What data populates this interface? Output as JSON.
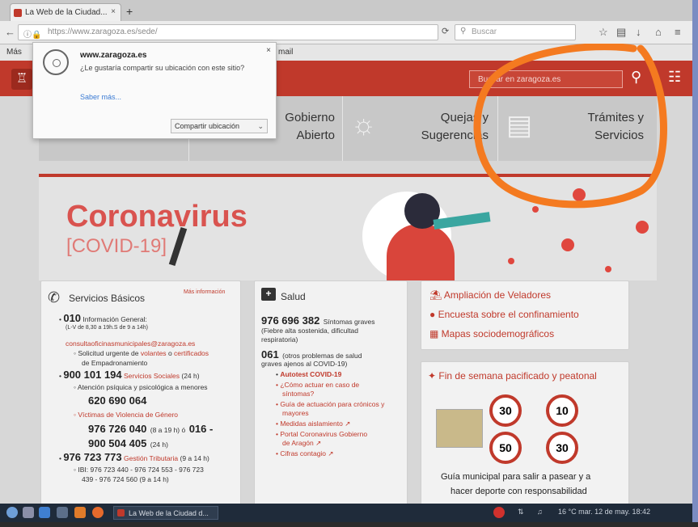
{
  "browser": {
    "tab_title": "La Web de la Ciudad...",
    "tab_close": "×",
    "new_tab": "+",
    "url": "https://www.zaragoza.es/sede/",
    "search_placeholder": "Buscar",
    "bookmarks": [
      "Más",
      "mail"
    ]
  },
  "site": {
    "search_placeholder": "Buscar en zaragoza.es",
    "tiles": [
      {
        "label_1": "Gobierno",
        "label_2": "Abierto"
      },
      {
        "label_1": "Quejas y",
        "label_2": "Sugerencias"
      },
      {
        "label_1": "Trámites y",
        "label_2": "Servicios"
      }
    ],
    "banner": {
      "title": "Coronavirus",
      "subtitle": "[COVID-19]"
    }
  },
  "permission_popup": {
    "site": "www.zaragoza.es",
    "question": "¿Le gustaría compartir su ubicación con este sitio?",
    "learn_more": "Saber más...",
    "share_button": "Compartir ubicación",
    "close": "×"
  },
  "servicios_basicos": {
    "title": "Servicios Básicos",
    "more": "Más información",
    "l1_num": "010",
    "l1_text": "Información General:",
    "l1_hours": "(L-V de 8,30 a 19h.S de 9 a 14h)",
    "email": "consultaoficinasmunicipales@zaragoza.es",
    "l2_pre": "Solicitud urgente de",
    "l2_link1": "volantes",
    "l2_mid": "o",
    "l2_link2": "certificados",
    "l2_post": "de Empadronamiento",
    "l3_num": "900 101 194",
    "l3_text": "Servicios Sociales",
    "l3_hours": "(24 h)",
    "l4_text": "Atención psíquica y psicológica a menores",
    "l4_num": "620 690 064",
    "l5_text": "Víctimas de Violencia de Género",
    "l5_num1": "976 726 040",
    "l5_hours1": "(8 a 19 h) ó",
    "l5_num2": "016 -",
    "l5_num3": "900 504 405",
    "l5_hours2": "(24 h)",
    "l6_num": "976 723 773",
    "l6_text": "Gestión Tributaria",
    "l6_hours": "(9 a 14 h)",
    "l7_text": "IBI: 976 723 440 - 976 724 553 - 976 723",
    "l7_text2": "439 - 976 724 560 (9 a 14 h)"
  },
  "salud": {
    "title": "Salud",
    "num1": "976 696 382",
    "num1_text": "Síntomas graves",
    "num1_desc": "(Fiebre alta sostenida, dificultad",
    "num1_desc2": "respiratoria)",
    "num2": "061",
    "num2_text": "(otros problemas de salud",
    "num2_text2": "graves ajenos al COVID-19)",
    "items": [
      "Autotest COVID-19",
      "¿Cómo actuar en caso de",
      "síntomas?",
      "Guía de actuación para crónicos y",
      "mayores",
      "Medidas aislamiento",
      "Portal Coronavirus Gobierno",
      "de Aragón",
      "Cifras contagio"
    ]
  },
  "links_card": {
    "items": [
      "Ampliación de Veladores",
      "Encuesta sobre el confinamiento",
      "Mapas sociodemográficos"
    ]
  },
  "fin_semana": {
    "title": "Fin de semana pacificado y peatonal",
    "speeds": [
      "30",
      "10",
      "50",
      "30"
    ],
    "caption1": "Guía municipal para salir a pasear y a",
    "caption2": "hacer deporte con responsabilidad"
  },
  "taskbar": {
    "window": "La Web de la Ciudad d...",
    "tray": "16 °C   mar. 12 de may. 18:42"
  },
  "colors": {
    "brand": "#c0392b",
    "annotation": "#f47a20"
  }
}
